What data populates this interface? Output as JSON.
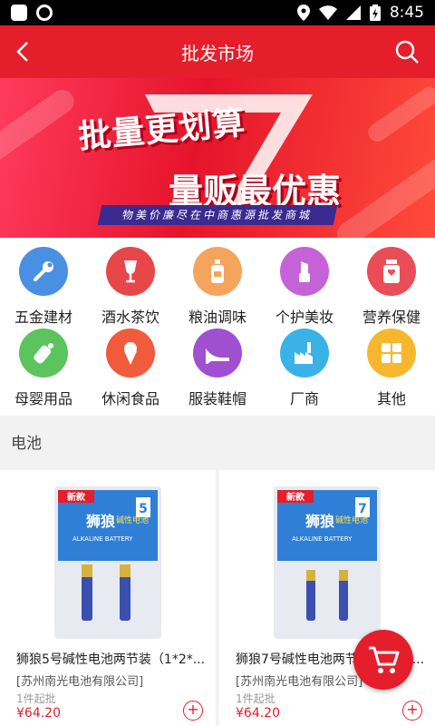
{
  "status_bar": {
    "time": "8:45"
  },
  "header": {
    "title": "批发市场"
  },
  "banner": {
    "headline1": "批量更划算",
    "headline2": "量贩最优惠",
    "slogan": "物美价廉尽在中商惠源批发商城"
  },
  "categories": [
    {
      "label": "五金建材",
      "icon": "wrench-icon",
      "color": "#4a90e2"
    },
    {
      "label": "酒水茶饮",
      "icon": "wine-glass-icon",
      "color": "#e8474a"
    },
    {
      "label": "粮油调味",
      "icon": "oil-bottle-icon",
      "color": "#f5a45c"
    },
    {
      "label": "个护美妆",
      "icon": "lipstick-icon",
      "color": "#c462d8"
    },
    {
      "label": "营养保健",
      "icon": "health-jar-icon",
      "color": "#ea4d57"
    },
    {
      "label": "母婴用品",
      "icon": "baby-bottle-icon",
      "color": "#5cc45d"
    },
    {
      "label": "休闲食品",
      "icon": "ice-cream-icon",
      "color": "#f15a3a"
    },
    {
      "label": "服装鞋帽",
      "icon": "high-heel-icon",
      "color": "#a04fd1"
    },
    {
      "label": "厂商",
      "icon": "factory-icon",
      "color": "#3ab2e8"
    },
    {
      "label": "其他",
      "icon": "grid-icon",
      "color": "#f7b72d"
    }
  ],
  "section": {
    "title": "电池"
  },
  "products": [
    {
      "name": "狮狼5号碱性电池两节装（1*2*...",
      "shop": "[苏州南光电池有限公司]",
      "moq": "1件起批",
      "price": "¥64.20",
      "pack_badge": "新款",
      "pack_brand": "狮狼",
      "pack_size": "5",
      "pack_type": "碱性电池",
      "pack_sub": "ALKALINE BATTERY"
    },
    {
      "name": "狮狼7号碱性电池两节装（1*2*...",
      "shop": "[苏州南光电池有限公司]",
      "moq": "1件起批",
      "price": "¥64.20",
      "pack_badge": "新款",
      "pack_brand": "狮狼",
      "pack_size": "7",
      "pack_type": "碱性电池",
      "pack_sub": "ALKALINE BATTERY"
    }
  ],
  "colors": {
    "brand_red": "#e41e2b"
  }
}
